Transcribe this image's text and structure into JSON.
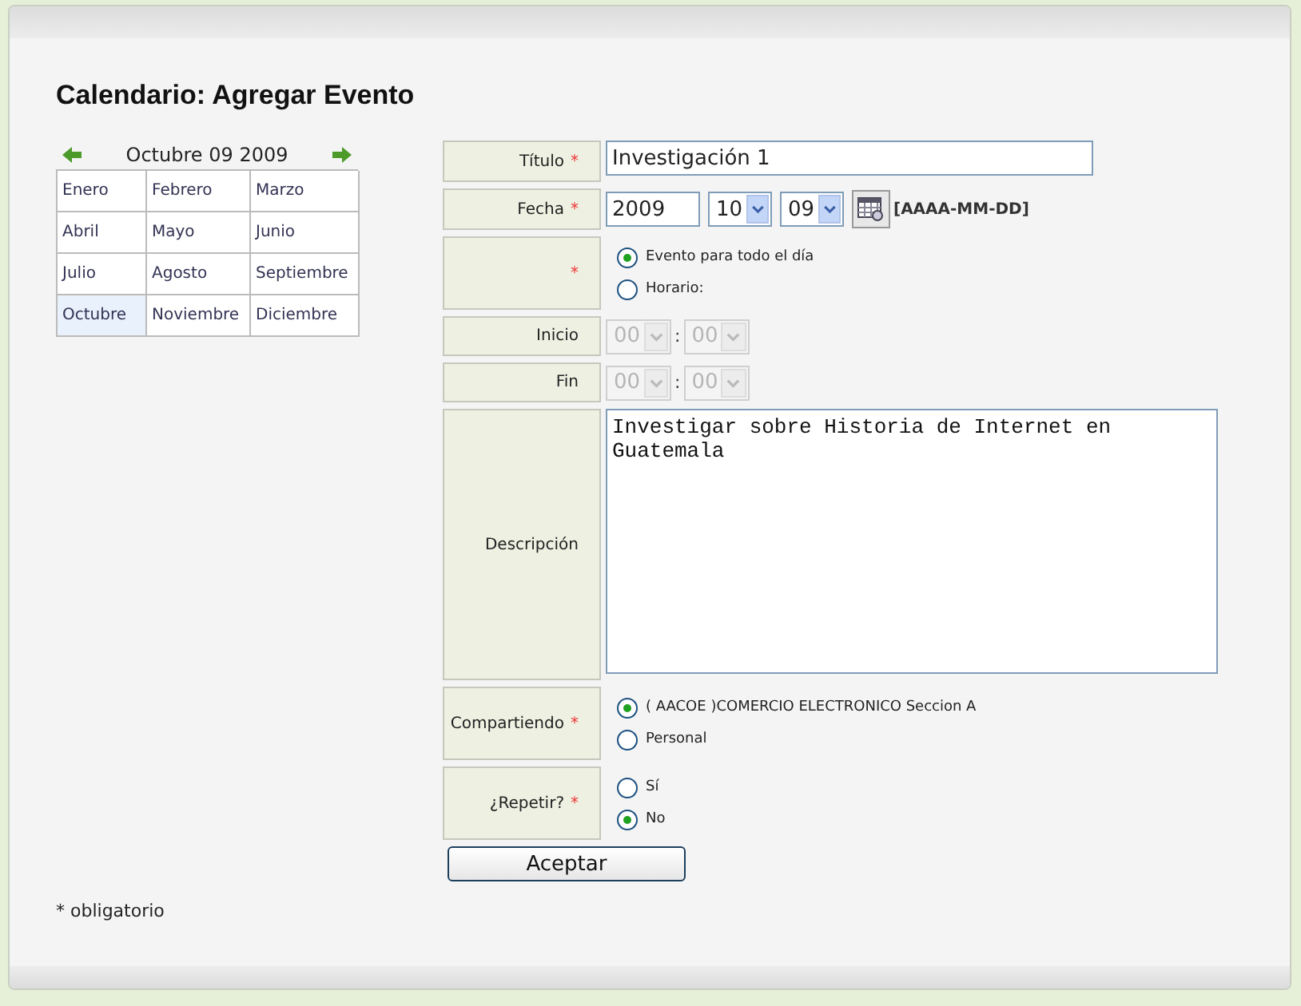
{
  "title": "Calendario: Agregar Evento",
  "calendar": {
    "header": "Octubre 09 2009",
    "months": [
      {
        "label": "Enero",
        "selected": false
      },
      {
        "label": "Febrero",
        "selected": false
      },
      {
        "label": "Marzo",
        "selected": false
      },
      {
        "label": "Abril",
        "selected": false
      },
      {
        "label": "Mayo",
        "selected": false
      },
      {
        "label": "Junio",
        "selected": false
      },
      {
        "label": "Julio",
        "selected": false
      },
      {
        "label": "Agosto",
        "selected": false
      },
      {
        "label": "Septiembre",
        "selected": false
      },
      {
        "label": "Octubre",
        "selected": true
      },
      {
        "label": "Noviembre",
        "selected": false
      },
      {
        "label": "Diciembre",
        "selected": false
      }
    ]
  },
  "form": [
    {
      "kind": "text",
      "label": "Título",
      "mark": "*",
      "value": "Investigación 1"
    },
    {
      "kind": "date",
      "label": "Fecha",
      "mark": "*",
      "year": "2009",
      "month": "10",
      "day": "09",
      "format": "[AAAA-MM-DD]"
    },
    {
      "kind": "radios",
      "mark": "*",
      "options": [
        {
          "label": "Evento para todo el día",
          "selected": true
        },
        {
          "label": "Horario:",
          "selected": false
        }
      ]
    },
    {
      "kind": "time",
      "label": "Inicio",
      "disabled": true,
      "hour": "00",
      "separator": ":",
      "minute": "00"
    },
    {
      "kind": "time",
      "label": "Fin",
      "disabled": true,
      "hour": "00",
      "separator": ":",
      "minute": "00"
    },
    {
      "kind": "textarea",
      "label": "Descripción",
      "value": "Investigar sobre Historia de Internet en Guatemala"
    },
    {
      "kind": "radios",
      "label": "Compartiendo",
      "mark": "*",
      "options": [
        {
          "label": "( AACOE )COMERCIO ELECTRONICO Seccion A",
          "selected": true
        },
        {
          "label": "Personal",
          "selected": false
        }
      ]
    },
    {
      "kind": "radios",
      "label": "¿Repetir?",
      "mark": "*",
      "options": [
        {
          "label": "Sí",
          "selected": false
        },
        {
          "label": "No",
          "selected": true
        }
      ]
    }
  ],
  "submit": "Aceptar",
  "footnote": "* obligatorio"
}
